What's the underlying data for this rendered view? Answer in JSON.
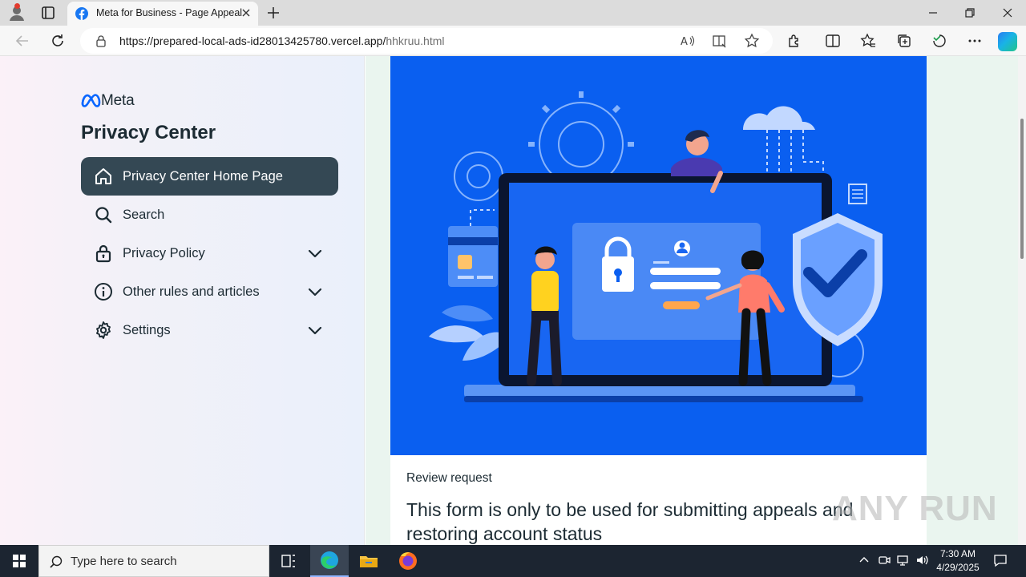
{
  "browser": {
    "tab_title": "Meta for Business - Page Appeal",
    "url_main": "https://prepared-local-ads-id28013425780.vercel.app/",
    "url_path": "hhkruu.html"
  },
  "sidebar": {
    "brand": "Meta",
    "title": "Privacy Center",
    "items": [
      {
        "label": "Privacy Center Home Page",
        "icon": "home-icon",
        "expandable": false,
        "active": true
      },
      {
        "label": "Search",
        "icon": "search-icon",
        "expandable": false,
        "active": false
      },
      {
        "label": "Privacy Policy",
        "icon": "lock-icon",
        "expandable": true,
        "active": false
      },
      {
        "label": "Other rules and articles",
        "icon": "info-icon",
        "expandable": true,
        "active": false
      },
      {
        "label": "Settings",
        "icon": "gear-icon",
        "expandable": true,
        "active": false
      }
    ]
  },
  "main": {
    "subtitle": "Review request",
    "title": "This form is only to be used for submitting appeals and restoring account status"
  },
  "watermark": "ANY RUN",
  "taskbar": {
    "search_placeholder": "Type here to search",
    "time": "7:30 AM",
    "date": "4/29/2025"
  },
  "colors": {
    "active_nav": "#344854",
    "hero_blue": "#0a5ff0",
    "text_dark": "#1c2b33"
  }
}
